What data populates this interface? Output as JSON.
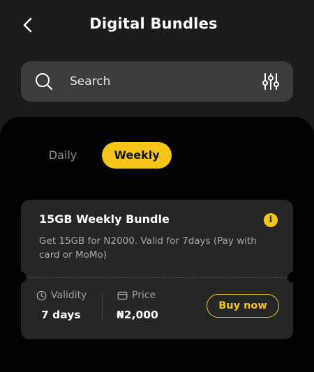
{
  "header": {
    "title": "Digital Bundles",
    "back_icon": "chevron-left-icon"
  },
  "search": {
    "placeholder": "Search",
    "value": "",
    "icon": "search-icon",
    "filter_icon": "sliders-icon"
  },
  "tabs": [
    {
      "label": "Daily",
      "selected": false
    },
    {
      "label": "Weekly",
      "selected": true
    }
  ],
  "bundle": {
    "title": "15GB Weekly Bundle",
    "description": "Get 15GB for N2000. Valid for 7days (Pay with card or MoMo)",
    "info_icon": "info-icon",
    "info_glyph": "i",
    "validity_label": "Validity",
    "validity_value": "7 days",
    "price_label": "Price",
    "price_value": "₦2,000",
    "buy_label": "Buy now"
  },
  "colors": {
    "accent": "#f5c518",
    "background": "#1b1b1b",
    "panel": "#020202",
    "card": "#262626",
    "search_bg": "#3c3c3c"
  }
}
